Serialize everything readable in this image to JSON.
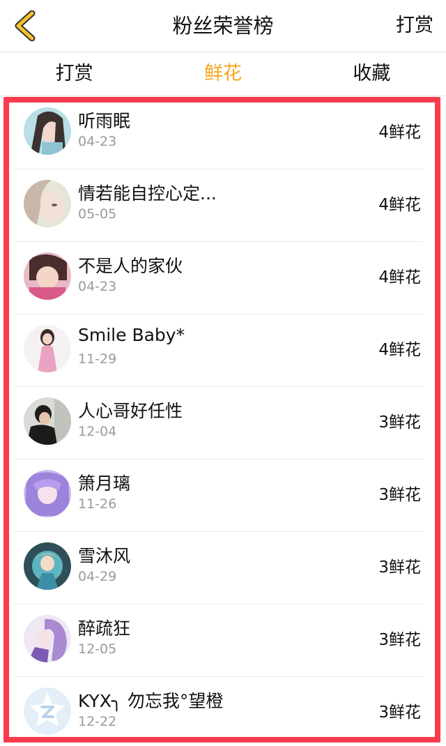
{
  "navbar": {
    "title": "粉丝荣誉榜",
    "right_action": "打赏",
    "back_icon": "chevron-left-icon",
    "back_icon_color": "#f4c32b"
  },
  "tabs": [
    {
      "label": "打赏",
      "active": false
    },
    {
      "label": "鲜花",
      "active": true
    },
    {
      "label": "收藏",
      "active": false
    }
  ],
  "colors": {
    "accent": "#f7a31c",
    "highlight_frame": "#fb3a4b",
    "date_text": "#9a9a9a"
  },
  "fans": [
    {
      "name": "听雨眠",
      "date": "04-23",
      "count": "4鲜花",
      "avatar": "avatar-photo"
    },
    {
      "name": "情若能自控心定...",
      "date": "05-05",
      "count": "4鲜花",
      "avatar": "avatar-photo"
    },
    {
      "name": "不是人的家伙",
      "date": "04-23",
      "count": "4鲜花",
      "avatar": "avatar-photo"
    },
    {
      "name": "Smile Baby*",
      "date": "11-29",
      "count": "4鲜花",
      "avatar": "avatar-photo"
    },
    {
      "name": "人心哥好任性",
      "date": "12-04",
      "count": "3鲜花",
      "avatar": "avatar-photo"
    },
    {
      "name": "箫月璃",
      "date": "11-26",
      "count": "3鲜花",
      "avatar": "avatar-photo"
    },
    {
      "name": "雪沐风",
      "date": "04-29",
      "count": "3鲜花",
      "avatar": "avatar-photo"
    },
    {
      "name": "醉疏狂",
      "date": "12-05",
      "count": "3鲜花",
      "avatar": "avatar-photo"
    },
    {
      "name": "KYX╮ 勿忘我°望橙",
      "date": "12-22",
      "count": "3鲜花",
      "avatar": "default-qq-avatar-icon"
    }
  ]
}
